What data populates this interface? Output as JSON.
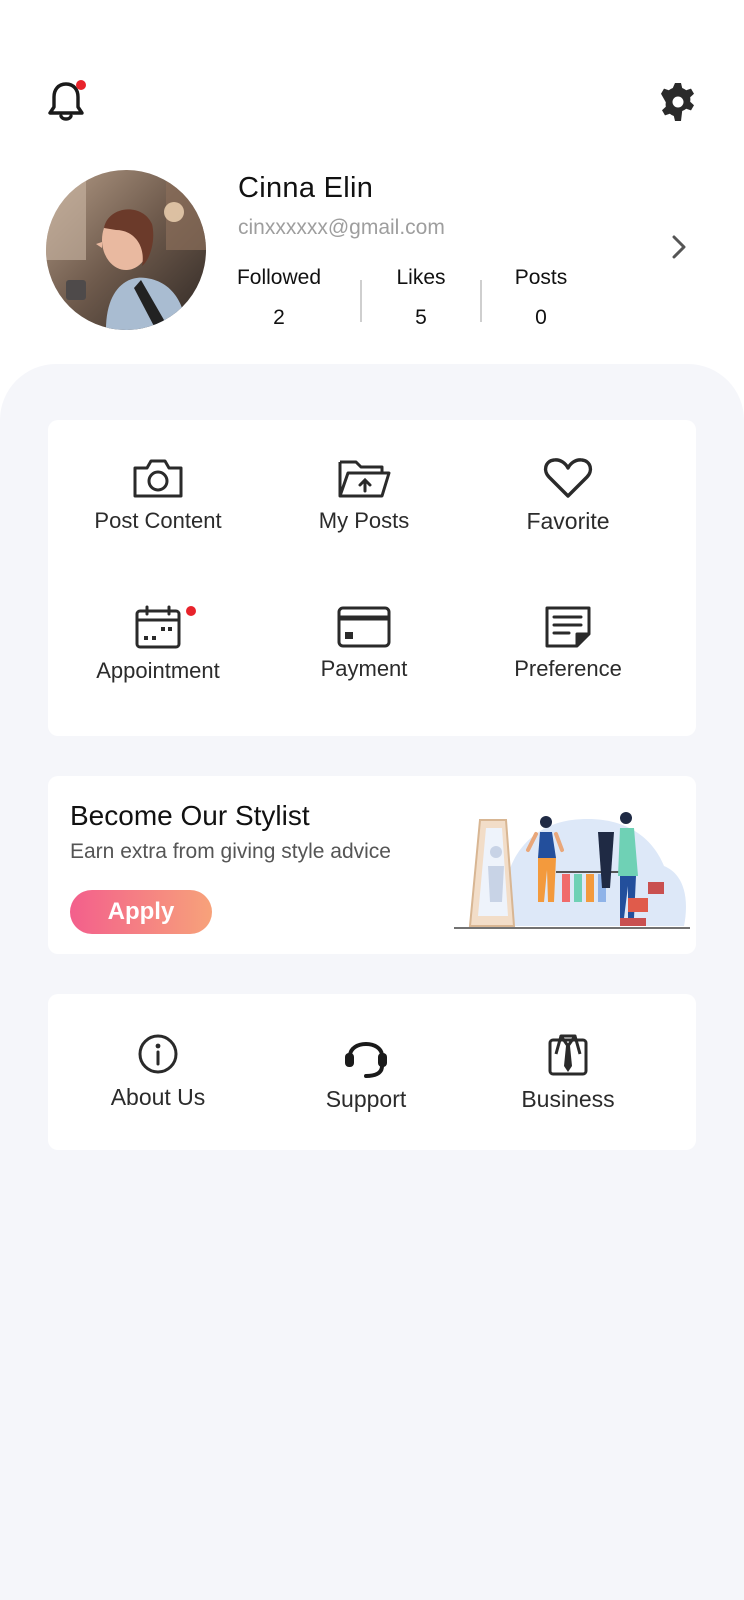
{
  "header": {
    "notification_icon": "bell-icon",
    "settings_icon": "gear-icon",
    "colors": {
      "badge": "#e8232b"
    }
  },
  "profile": {
    "name": "Cinna Elin",
    "email": "cinxxxxxx@gmail.com",
    "stats": [
      {
        "label": "Followed",
        "value": "2"
      },
      {
        "label": "Likes",
        "value": "5"
      },
      {
        "label": "Posts",
        "value": "0"
      }
    ]
  },
  "menu": {
    "items": [
      {
        "label": "Post Content",
        "icon": "camera-icon"
      },
      {
        "label": "My Posts",
        "icon": "folder-upload-icon"
      },
      {
        "label": "Favorite",
        "icon": "heart-icon"
      },
      {
        "label": "Appointment",
        "icon": "calendar-icon"
      },
      {
        "label": "Payment",
        "icon": "card-icon"
      },
      {
        "label": "Preference",
        "icon": "note-icon"
      }
    ]
  },
  "stylist": {
    "title": "Become Our Stylist",
    "subtitle": "Earn extra from giving style advice",
    "button": "Apply",
    "colors": {
      "gradient_start": "#f35f8c",
      "gradient_end": "#f7a27a"
    }
  },
  "footer_menu": {
    "items": [
      {
        "label": "About Us",
        "icon": "info-icon"
      },
      {
        "label": "Support",
        "icon": "headset-icon"
      },
      {
        "label": "Business",
        "icon": "suit-icon"
      }
    ]
  }
}
